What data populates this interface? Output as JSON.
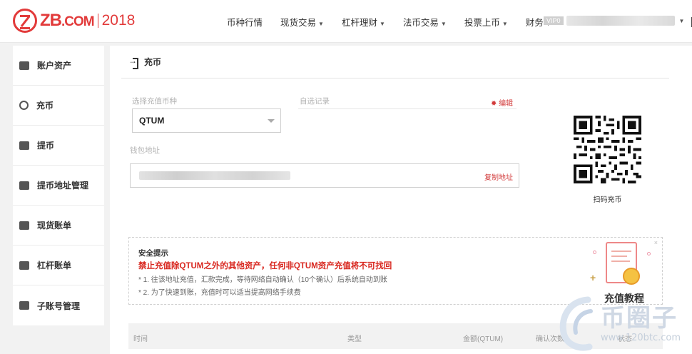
{
  "brand": {
    "name": "ZB",
    "domain_suffix": ".COM",
    "year": "2018"
  },
  "nav": {
    "items": [
      {
        "label": "币种行情",
        "has_caret": false
      },
      {
        "label": "现货交易",
        "has_caret": true
      },
      {
        "label": "杠杆理财",
        "has_caret": true
      },
      {
        "label": "法币交易",
        "has_caret": true
      },
      {
        "label": "投票上币",
        "has_caret": true
      },
      {
        "label": "财务",
        "has_caret": true
      }
    ],
    "user_badge": "VIP0"
  },
  "sidebar": {
    "items": [
      {
        "label": "账户资产",
        "icon": "wallet-icon"
      },
      {
        "label": "充币",
        "icon": "deposit-icon"
      },
      {
        "label": "提币",
        "icon": "withdraw-icon"
      },
      {
        "label": "提币地址管理",
        "icon": "address-book-icon"
      },
      {
        "label": "现货账单",
        "icon": "spot-bill-icon"
      },
      {
        "label": "杠杆账单",
        "icon": "margin-bill-icon"
      },
      {
        "label": "子账号管理",
        "icon": "sub-account-icon"
      }
    ]
  },
  "page": {
    "title": "充币",
    "select_label": "选择充值币种",
    "selected_coin": "QTUM",
    "self_record_label": "自选记录",
    "edit_label": "编辑",
    "wallet_label": "钱包地址",
    "copy_label": "复制地址",
    "qr_caption": "扫码充币"
  },
  "notice": {
    "title": "安全提示",
    "warning": "禁止充值除QTUM之外的其他资产，任何非QTUM资产充值将不可找回",
    "lines": [
      "* 1. 往该地址充值，汇款完成，等待网络自动确认（10个确认）后系统自动到账",
      "* 2. 为了快速到账，充值时可以适当提高网络手续费"
    ],
    "close_label": "×",
    "tutorial_label": "充值教程",
    "tutorial_plus": "+"
  },
  "table": {
    "headers": [
      "时间",
      "类型",
      "金额(QTUM)",
      "确认次数",
      "状态"
    ]
  },
  "watermark": {
    "title": "币圈子",
    "url": "www.120btc.com"
  },
  "colors": {
    "brand_red": "#e23a3a",
    "warning_red": "#d8261e",
    "link_red": "#d23a3a"
  }
}
